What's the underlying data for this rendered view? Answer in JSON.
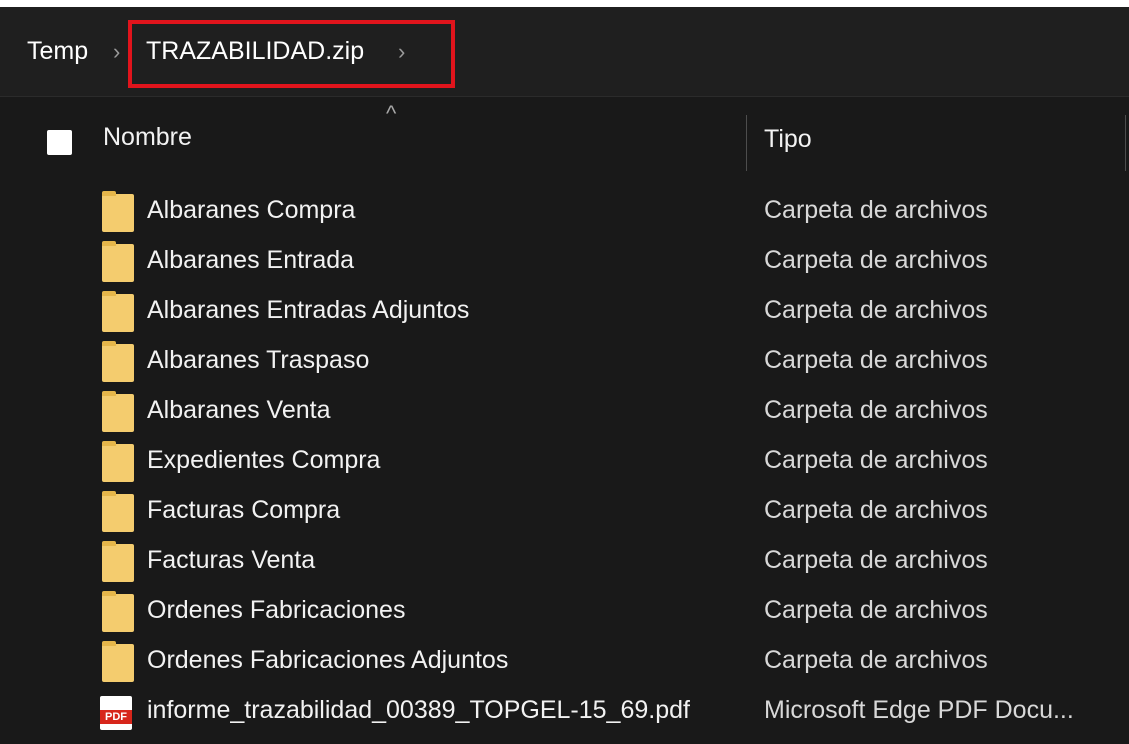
{
  "breadcrumb": {
    "items": [
      "Temp",
      "TRAZABILIDAD.zip"
    ],
    "separator": "›"
  },
  "header": {
    "sort_indicator": "^",
    "columns": {
      "name": "Nombre",
      "type": "Tipo"
    }
  },
  "files": [
    {
      "name": "Albaranes Compra",
      "type": "Carpeta de archivos",
      "icon": "folder-icon"
    },
    {
      "name": "Albaranes Entrada",
      "type": "Carpeta de archivos",
      "icon": "folder-icon"
    },
    {
      "name": "Albaranes Entradas Adjuntos",
      "type": "Carpeta de archivos",
      "icon": "folder-icon"
    },
    {
      "name": "Albaranes Traspaso",
      "type": "Carpeta de archivos",
      "icon": "folder-icon"
    },
    {
      "name": "Albaranes Venta",
      "type": "Carpeta de archivos",
      "icon": "folder-icon"
    },
    {
      "name": "Expedientes Compra",
      "type": "Carpeta de archivos",
      "icon": "folder-icon"
    },
    {
      "name": "Facturas Compra",
      "type": "Carpeta de archivos",
      "icon": "folder-icon"
    },
    {
      "name": "Facturas Venta",
      "type": "Carpeta de archivos",
      "icon": "folder-icon"
    },
    {
      "name": "Ordenes Fabricaciones",
      "type": "Carpeta de archivos",
      "icon": "folder-icon"
    },
    {
      "name": "Ordenes Fabricaciones Adjuntos",
      "type": "Carpeta de archivos",
      "icon": "folder-icon"
    },
    {
      "name": "informe_trazabilidad_00389_TOPGEL-15_69.pdf",
      "type": "Microsoft Edge PDF Docu...",
      "icon": "pdf-icon",
      "icon_text": "PDF"
    }
  ],
  "colors": {
    "background": "#191919",
    "highlight": "#e0141c",
    "folder": "#f4cc6e",
    "pdf": "#d7261b"
  }
}
